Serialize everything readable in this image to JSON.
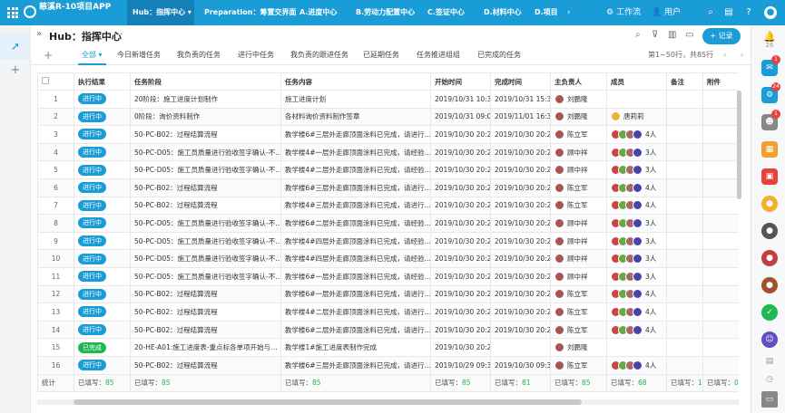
{
  "app": {
    "title": "慈溪R-10项目APP"
  },
  "nav": {
    "items": [
      "Hub：指挥中心",
      "Preparation：筹置交界面",
      "A.进度中心",
      "B.劳动力配置中心",
      "C.签证中心",
      "D.材料中心",
      "D.项目"
    ],
    "workflow": "工作流",
    "user": "用户"
  },
  "header": {
    "title": "Hub：指挥中心",
    "more": "···",
    "add_label": "+ 记录"
  },
  "tabs": {
    "add": "+",
    "items": [
      "全部",
      "今日新增任务",
      "我负责的任务",
      "进行中任务",
      "我负责的跟进任务",
      "已延期任务",
      "任务推进组组",
      "已完成的任务"
    ],
    "pager": "第1~50行，共85行"
  },
  "table": {
    "columns": [
      "",
      "执行结果",
      "任务阶段",
      "任务内容",
      "开始时间",
      "完成时间",
      "主负责人",
      "成员",
      "备注",
      "附件"
    ],
    "rows": [
      {
        "n": "1",
        "status": "进行中",
        "stage": "20阶段：施工进度计划制作",
        "content": "施工进度计划",
        "start": "2019/10/31 10:37",
        "end": "2019/10/31 15:37",
        "owner": "刘鹏隆",
        "members": ""
      },
      {
        "n": "2",
        "status": "进行中",
        "stage": "0阶段：询价资料制作",
        "content": "各材料询价资料制作签章",
        "start": "2019/10/31 09:01",
        "end": "2019/11/01 16:36",
        "owner": "刘鹏隆",
        "members": "唐莉莉"
      },
      {
        "n": "3",
        "status": "进行中",
        "stage": "50-PC-B02：过程结算流程",
        "content": "教学楼6#三层外走廊顶面涂料已完成，请进行…",
        "start": "2019/10/30 20:24",
        "end": "2019/10/30 20:24",
        "owner": "陈立军",
        "members": "4人"
      },
      {
        "n": "4",
        "status": "进行中",
        "stage": "50-PC-D05：施工员质量进行验收签字确认-不…",
        "content": "教学楼4#一层外走廊顶面涂料已完成，请经验…",
        "start": "2019/10/30 20:24",
        "end": "2019/10/30 20:24",
        "owner": "顾中祥",
        "members": "3人"
      },
      {
        "n": "5",
        "status": "进行中",
        "stage": "50-PC-D05：施工员质量进行验收签字确认-不…",
        "content": "教学楼4#二层外走廊顶面涂料已完成，请经验…",
        "start": "2019/10/30 20:24",
        "end": "2019/10/30 20:24",
        "owner": "顾中祥",
        "members": "3人"
      },
      {
        "n": "6",
        "status": "进行中",
        "stage": "50-PC-B02：过程结算流程",
        "content": "教学楼6#三层外走廊顶面涂料已完成，请进行…",
        "start": "2019/10/30 20:24",
        "end": "2019/10/30 20:24",
        "owner": "陈立军",
        "members": "4人"
      },
      {
        "n": "7",
        "status": "进行中",
        "stage": "50-PC-B02：过程结算流程",
        "content": "教学楼4#三层外走廊顶面涂料已完成，请进行…",
        "start": "2019/10/30 20:24",
        "end": "2019/10/30 20:24",
        "owner": "陈立军",
        "members": "4人"
      },
      {
        "n": "8",
        "status": "进行中",
        "stage": "50-PC-D05：施工员质量进行验收签字确认-不…",
        "content": "教学楼6#二层外走廊顶面涂料已完成，请经验…",
        "start": "2019/10/30 20:24",
        "end": "2019/10/30 20:24",
        "owner": "顾中祥",
        "members": "3人"
      },
      {
        "n": "9",
        "status": "进行中",
        "stage": "50-PC-D05：施工员质量进行验收签字确认-不…",
        "content": "教学楼4#四层外走廊顶面涂料已完成，请经验…",
        "start": "2019/10/30 20:24",
        "end": "2019/10/30 20:24",
        "owner": "顾中祥",
        "members": "3人"
      },
      {
        "n": "10",
        "status": "进行中",
        "stage": "50-PC-D05：施工员质量进行验收签字确认-不…",
        "content": "教学楼4#四层外走廊顶面涂料已完成，请经验…",
        "start": "2019/10/30 20:24",
        "end": "2019/10/30 20:24",
        "owner": "顾中祥",
        "members": "3人"
      },
      {
        "n": "11",
        "status": "进行中",
        "stage": "50-PC-D05：施工员质量进行验收签字确认-不…",
        "content": "教学楼6#一层外走廊顶面涂料已完成，请经验…",
        "start": "2019/10/30 20:24",
        "end": "2019/10/30 20:24",
        "owner": "顾中祥",
        "members": "3人"
      },
      {
        "n": "12",
        "status": "进行中",
        "stage": "50-PC-B02：过程结算流程",
        "content": "教学楼6#一层外走廊顶面涂料已完成，请进行…",
        "start": "2019/10/30 20:24",
        "end": "2019/10/30 20:24",
        "owner": "陈立军",
        "members": "4人"
      },
      {
        "n": "13",
        "status": "进行中",
        "stage": "50-PC-B02：过程结算流程",
        "content": "教学楼4#二层外走廊顶面涂料已完成，请进行…",
        "start": "2019/10/30 20:24",
        "end": "2019/10/30 20:24",
        "owner": "陈立军",
        "members": "4人"
      },
      {
        "n": "14",
        "status": "进行中",
        "stage": "50-PC-B02：过程结算流程",
        "content": "教学楼6#二层外走廊顶面涂料已完成，请进行…",
        "start": "2019/10/30 20:24",
        "end": "2019/10/30 20:24",
        "owner": "陈立军",
        "members": "4人"
      },
      {
        "n": "15",
        "status": "已完成",
        "stage": "20-HE-A01:施工进度表-重点标各单项开始与…",
        "content": "教学楼1#施工进度表制作完成",
        "start": "2019/10/30 20:24",
        "end": "",
        "owner": "刘鹏隆",
        "members": ""
      },
      {
        "n": "16",
        "status": "进行中",
        "stage": "50-PC-B02：过程结算流程",
        "content": "教学楼6#三层外走廊顶面涂料已完成，请进行…",
        "start": "2019/10/29 09:34",
        "end": "2019/10/30 09:34",
        "owner": "陈立军",
        "members": "4人"
      }
    ],
    "footer": {
      "label": "统计",
      "filled": "已填写：",
      "c1": "85",
      "c2": "85",
      "c3": "85",
      "c4": "85",
      "c5": "81",
      "c6": "85",
      "c7": "68",
      "c8": "1",
      "c9": "0"
    }
  },
  "rightbar": {
    "count": "26",
    "badges": [
      "1",
      "24",
      "1"
    ]
  }
}
